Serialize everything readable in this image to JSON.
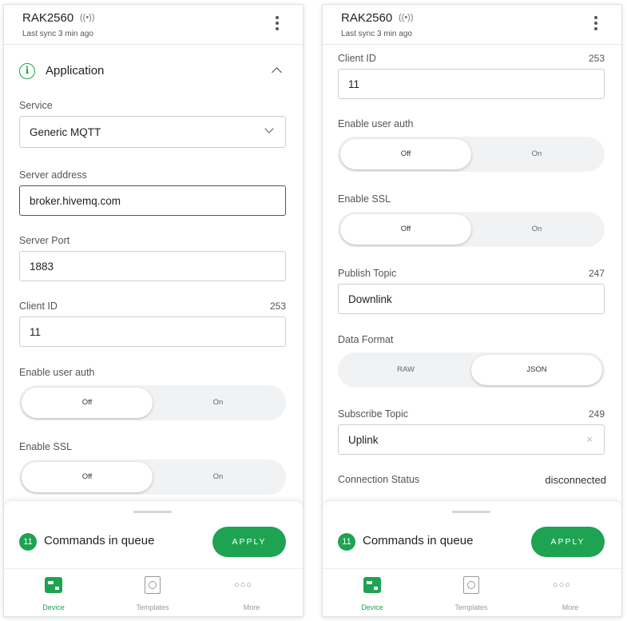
{
  "device": {
    "name": "RAK2560",
    "signal_glyph": "((•))",
    "last_sync": "Last sync 3 min ago"
  },
  "left_screen": {
    "section_title": "Application",
    "service_label": "Service",
    "service_value": "Generic MQTT",
    "server_address_label": "Server address",
    "server_address_value": "broker.hivemq.com",
    "server_port_label": "Server Port",
    "server_port_value": "1883",
    "client_id_label": "Client ID",
    "client_id_count": "253",
    "client_id_value": "11",
    "user_auth_label": "Enable user auth",
    "user_auth_off": "Off",
    "user_auth_on": "On",
    "ssl_label": "Enable SSL",
    "ssl_off": "Off",
    "ssl_on": "On"
  },
  "right_screen": {
    "client_id_label": "Client ID",
    "client_id_count": "253",
    "client_id_value": "11",
    "user_auth_label": "Enable user auth",
    "user_auth_off": "Off",
    "user_auth_on": "On",
    "ssl_label": "Enable SSL",
    "ssl_off": "Off",
    "ssl_on": "On",
    "publish_topic_label": "Publish Topic",
    "publish_topic_count": "247",
    "publish_topic_value": "Downlink",
    "data_format_label": "Data Format",
    "data_format_raw": "RAW",
    "data_format_json": "JSON",
    "subscribe_topic_label": "Subscribe Topic",
    "subscribe_topic_count": "249",
    "subscribe_topic_value": "Uplink",
    "clear_glyph": "×",
    "connection_status_label": "Connection Status",
    "connection_status_value": "disconnected"
  },
  "queue": {
    "count": "11",
    "text": "Commands in queue",
    "apply_label": "APPLY"
  },
  "nav": {
    "device": "Device",
    "templates": "Templates",
    "more": "More",
    "more_glyph": "○○○"
  },
  "colors": {
    "accent": "#1ea352",
    "toggle_track": "#f1f2f3"
  },
  "icons": [
    "signal-icon",
    "kebab-menu-icon",
    "info-icon",
    "chevron-up-icon",
    "chevron-down-icon",
    "clear-icon",
    "device-icon",
    "templates-icon",
    "more-icon"
  ]
}
